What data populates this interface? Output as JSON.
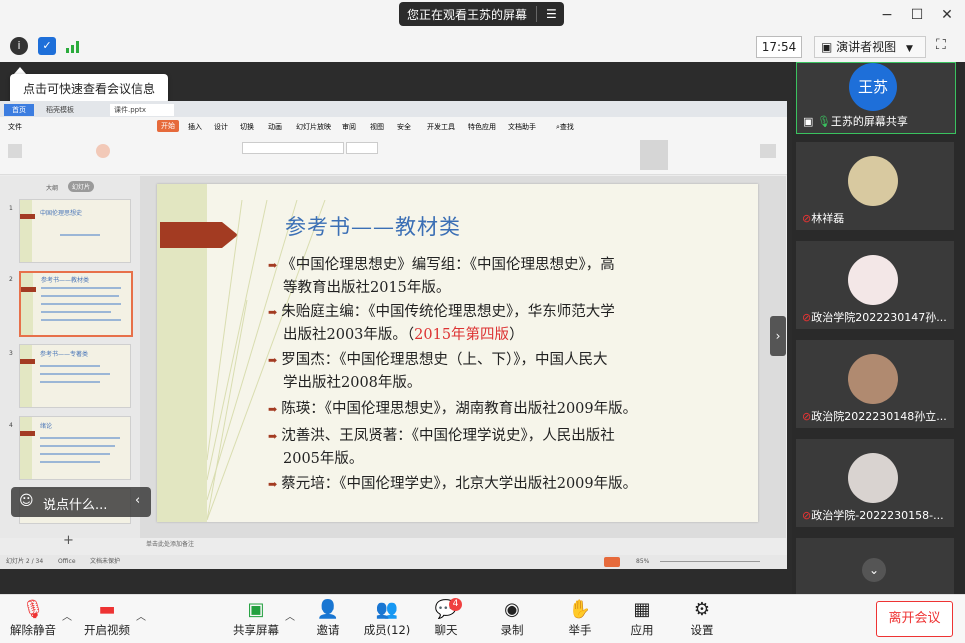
{
  "window": {
    "banner_text": "您正在观看王苏的屏幕",
    "banner_menu_icon": "list-icon",
    "minimize": "−",
    "maximize": "☐",
    "close": "✕"
  },
  "topbar": {
    "time": "17:54",
    "view_button": "演讲者视图",
    "tooltip": "点击可快速查看会议信息"
  },
  "wps": {
    "tabs": [
      "首页",
      "稻壳模板",
      "课件.pptx"
    ],
    "menu_items": [
      "文件",
      "开始",
      "插入",
      "设计",
      "切换",
      "动画",
      "幻灯片放映",
      "审阅",
      "视图",
      "安全",
      "开发工具",
      "特色应用",
      "文档助手",
      "查找"
    ],
    "sidebar_tabs": [
      "大纲",
      "幻灯片"
    ],
    "notes_placeholder": "单击此处添加备注",
    "status_left": "幻灯片 2 / 34",
    "status_theme": "Office",
    "status_protect": "文档未保护",
    "zoom": "85%"
  },
  "slide": {
    "title": "参考书——教材类",
    "bullets": [
      [
        "《中国伦理思想史》编写组：《中国伦理思想史》，高",
        "等教育出版社2015年版。"
      ],
      [
        "朱贻庭主编：《中国传统伦理思想史》，华东师范大学",
        "出版社2003年版。（",
        "2015年第四版",
        "）"
      ],
      [
        "罗国杰：《中国伦理思想史（上、下）》，中国人民大",
        "学出版社2008年版。"
      ],
      [
        "陈瑛：《中国伦理思想史》，湖南教育出版社2009年版。"
      ],
      [
        "沈善洪、王凤贤著：《中国伦理学说史》，人民出版社",
        "2005年版。"
      ],
      [
        "蔡元培：《中国伦理学史》，北京大学出版社2009年版。"
      ]
    ]
  },
  "thumbnails": {
    "items": [
      {
        "num": "1",
        "title": "中国伦理思想史"
      },
      {
        "num": "2",
        "title": "参考书——教材类"
      },
      {
        "num": "3",
        "title": "参考书——专著类"
      },
      {
        "num": "4",
        "title": "绪论"
      }
    ]
  },
  "chat_prompt": "说点什么...",
  "participants": [
    {
      "name": "王苏的屏幕共享",
      "avatar_text": "王苏",
      "color": "#1e6fd9"
    },
    {
      "name": "林祥磊",
      "avatar_text": "",
      "color": "#d8c9a0"
    },
    {
      "name": "政治学院2022230147孙...",
      "avatar_text": "",
      "color": "#f3e7e7"
    },
    {
      "name": "政治院2022230148孙立...",
      "avatar_text": "",
      "color": "#b08a70"
    },
    {
      "name": "政治学院-2022230158-...",
      "avatar_text": "",
      "color": "#d9d3d0"
    }
  ],
  "toolbar": {
    "mute": "解除静音",
    "video": "开启视频",
    "share": "共享屏幕",
    "invite": "邀请",
    "members": "成员(12)",
    "chat": "聊天",
    "chat_badge": "4",
    "record": "录制",
    "hand": "举手",
    "apps": "应用",
    "settings": "设置",
    "leave": "离开会议"
  }
}
